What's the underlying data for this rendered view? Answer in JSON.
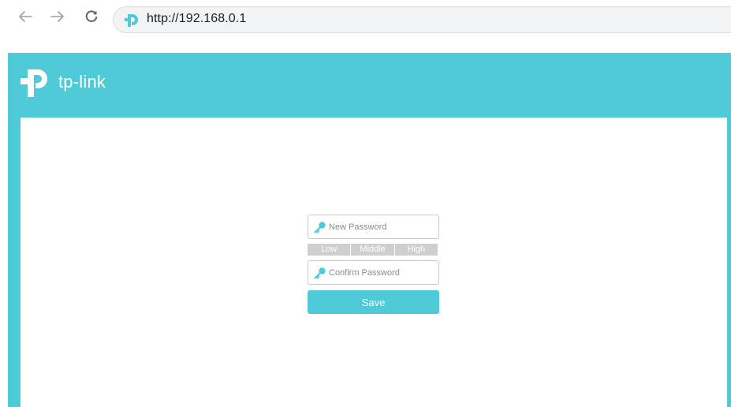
{
  "browser": {
    "url": "http://192.168.0.1",
    "icons": {
      "back": "arrow-left-icon",
      "forward": "arrow-right-icon",
      "reload": "reload-icon",
      "site": "tp-link-favicon"
    }
  },
  "brand": {
    "logo_text": "tp-link",
    "accent_color": "#4ecbd6"
  },
  "form": {
    "new_password_placeholder": "New Password",
    "strength_levels": [
      "Low",
      "Middle",
      "High"
    ],
    "confirm_password_placeholder": "Confirm Password",
    "save_label": "Save"
  }
}
